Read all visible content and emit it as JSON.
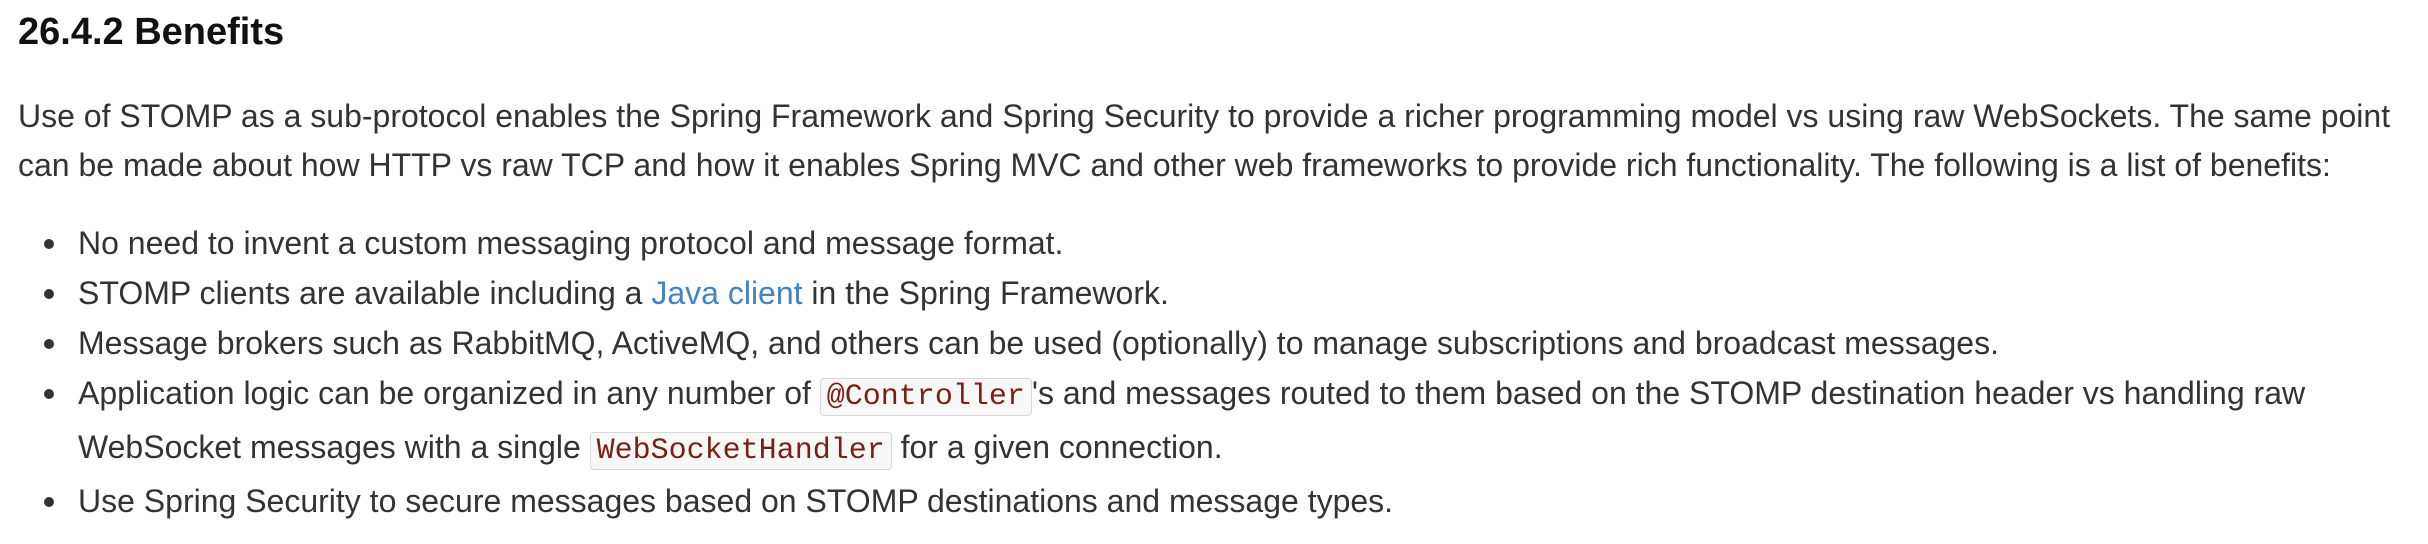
{
  "section": {
    "title": "26.4.2 Benefits"
  },
  "intro": "Use of STOMP as a sub-protocol enables the Spring Framework and Spring Security to provide a richer programming model vs using raw WebSockets. The same point can be made about how HTTP vs raw TCP and how it enables Spring MVC and other web frameworks to provide rich functionality. The following is a list of benefits:",
  "benefits": {
    "item1": "No need to invent a custom messaging protocol and message format.",
    "item2": {
      "before": "STOMP clients are available including a ",
      "link": "Java client",
      "after": " in the Spring Framework."
    },
    "item3": "Message brokers such as RabbitMQ, ActiveMQ, and others can be used (optionally) to manage subscriptions and broadcast messages.",
    "item4": {
      "before": "Application logic can be organized in any number of ",
      "code1": "@Controller",
      "middle": "'s and messages routed to them based on the STOMP destination header vs handling raw WebSocket messages with a single ",
      "code2": "WebSocketHandler",
      "after": " for a given connection."
    },
    "item5": "Use Spring Security to secure messages based on STOMP destinations and message types."
  },
  "colors": {
    "text": "#333333",
    "link": "#4183c4",
    "code": "#7a1f12"
  }
}
